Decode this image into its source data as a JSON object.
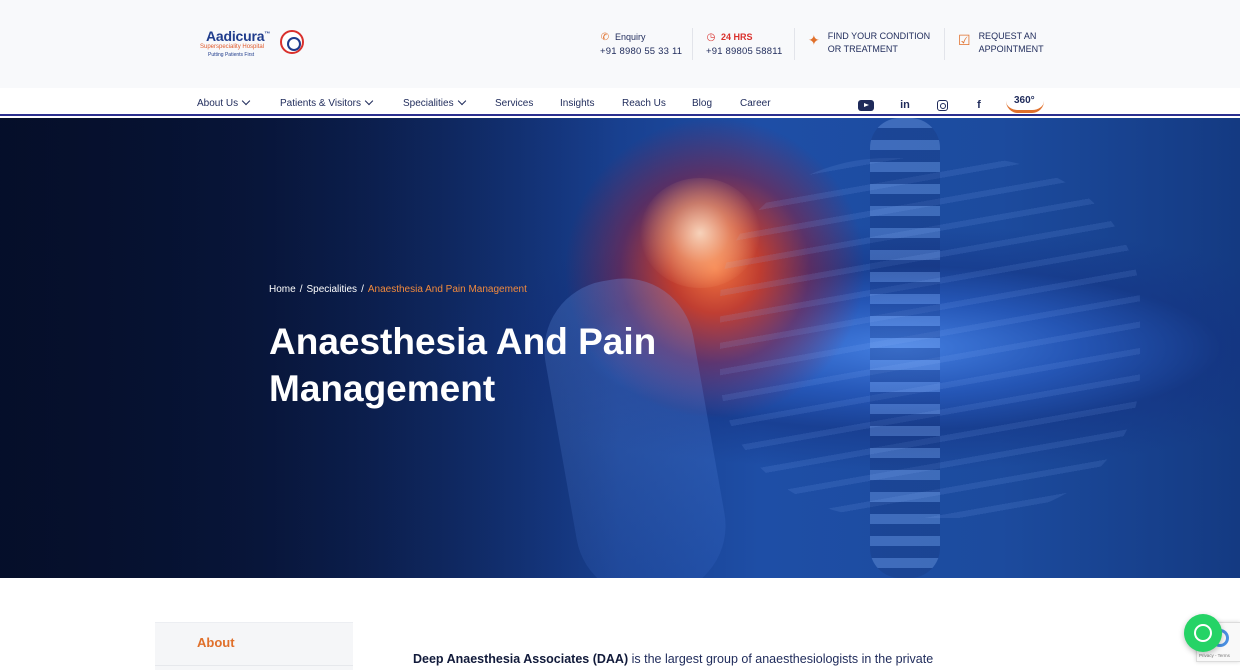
{
  "brand": {
    "name": "Aadicura",
    "tm": "™",
    "subtitle": "Superspeciality Hospital",
    "tagline": "Putting Patients First"
  },
  "header": {
    "enquiry": {
      "icon": "phone-icon",
      "label": "Enquiry",
      "number": "+91 8980 55 33 11"
    },
    "emergency": {
      "icon": "clock-icon",
      "label": "24 HRS",
      "number": "+91 89805 58811"
    },
    "find_condition": {
      "icon": "body-icon",
      "line1": "FIND YOUR CONDITION",
      "line2": "OR TREATMENT"
    },
    "appointment": {
      "icon": "calendar-check-icon",
      "line1": "REQUEST AN",
      "line2": "APPOINTMENT"
    }
  },
  "nav": {
    "items": [
      {
        "label": "About Us",
        "dropdown": true
      },
      {
        "label": "Patients & Visitors",
        "dropdown": true
      },
      {
        "label": "Specialities",
        "dropdown": true
      },
      {
        "label": "Services",
        "dropdown": false
      },
      {
        "label": "Insights",
        "dropdown": false
      },
      {
        "label": "Reach Us",
        "dropdown": false
      },
      {
        "label": "Blog",
        "dropdown": false
      },
      {
        "label": "Career",
        "dropdown": false
      }
    ],
    "social": [
      "youtube-icon",
      "linkedin-icon",
      "instagram-icon",
      "facebook-icon"
    ],
    "linkedin_glyph": "in",
    "facebook_glyph": "f",
    "tour_label": "360°"
  },
  "hero": {
    "breadcrumb": {
      "home": "Home",
      "sep": "/",
      "parent": "Specialities",
      "current": "Anaesthesia And Pain Management"
    },
    "title_line1": "Anaesthesia And Pain",
    "title_line2": "Management"
  },
  "sidebar": {
    "active_item": "About"
  },
  "content": {
    "intro_bold": "Deep Anaesthesia Associates (DAA)",
    "intro_rest": " is the largest group of anaesthesiologists in the private"
  },
  "widgets": {
    "recaptcha_text": "Privacy - Terms"
  },
  "colors": {
    "navy": "#1e2a5a",
    "accent_orange": "#e0702b",
    "brand_red": "#d9302c",
    "whatsapp_green": "#25d366"
  }
}
